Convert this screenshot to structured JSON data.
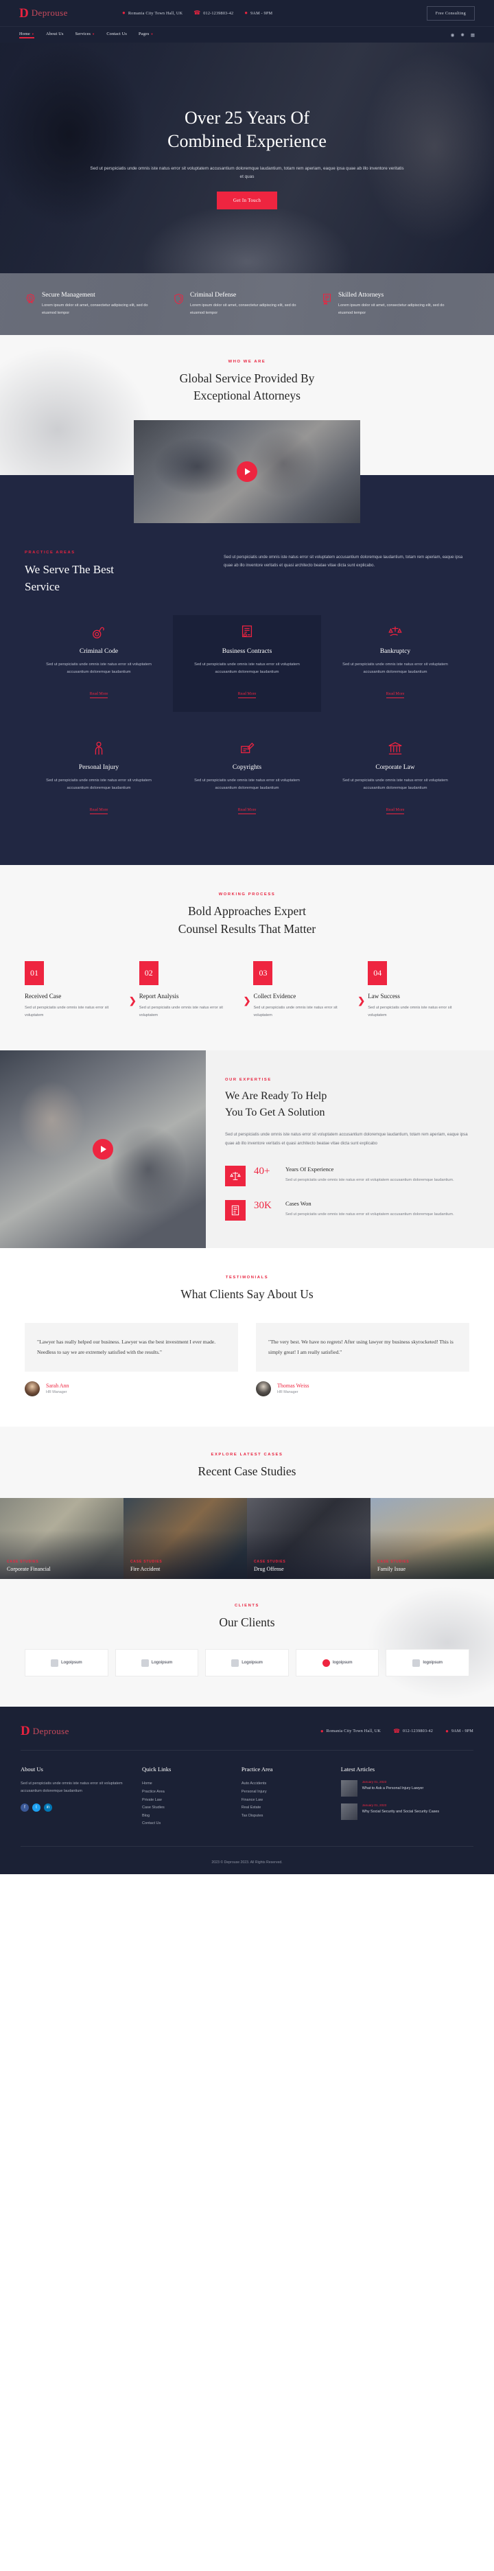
{
  "brand": {
    "mark": "D",
    "name": "Deprouse"
  },
  "topbar": {
    "info": [
      {
        "icon": "location-pin-icon",
        "text": "Romania City Town Hall, UK"
      },
      {
        "icon": "phone-icon",
        "text": "012-1239803-42"
      },
      {
        "icon": "clock-icon",
        "text": "9AM - 9PM"
      }
    ],
    "cta": "Free Consulting"
  },
  "nav": {
    "items": [
      {
        "label": "Home",
        "caret": true,
        "active": true
      },
      {
        "label": "About Us",
        "caret": false,
        "active": false
      },
      {
        "label": "Services",
        "caret": true,
        "active": false
      },
      {
        "label": "Contact Us",
        "caret": false,
        "active": false
      },
      {
        "label": "Pages",
        "caret": true,
        "active": false
      }
    ],
    "social": [
      {
        "icon": "facebook-icon",
        "glyph": "f"
      },
      {
        "icon": "twitter-icon",
        "glyph": "t"
      },
      {
        "icon": "linkedin-icon",
        "glyph": "in"
      }
    ]
  },
  "hero": {
    "title_line1": "Over 25 Years Of",
    "title_line2": "Combined Experience",
    "description": "Sed ut perspiciatis unde omnis iste natus error sit voluptatem accusantium doloremque laudantium, totam rem aperiam, eaque ipsa quae ab illo inventore veritatis et quas",
    "button": "Get In Touch"
  },
  "features": [
    {
      "icon": "badge-star-icon",
      "title": "Secure Management",
      "text": "Lorem ipsum dolor sit amet, consectetur adipiscing elit, sed do eiusmod tempor"
    },
    {
      "icon": "shield-icon",
      "title": "Criminal Defense",
      "text": "Lorem ipsum dolor sit amet, consectetur adipiscing elit, sed do eiusmod tempor"
    },
    {
      "icon": "certificate-icon",
      "title": "Skilled Attorneys",
      "text": "Lorem ipsum dolor sit amet, consectetur adipiscing elit, sed do eiusmod tempor"
    }
  ],
  "whoweare": {
    "eyebrow": "WHO WE ARE",
    "title_line1": "Global Service Provided By",
    "title_line2": "Exceptional Attorneys",
    "play": "play-button-icon"
  },
  "practice": {
    "eyebrow": "PRACTICE AREAS",
    "title_line1": "We Serve The Best",
    "title_line2": "Service",
    "description": "Sed ut perspiciatis unde omnis iste natus error sit voluptatem accusantium doloremque laudantium, totam rem aperiam, eaque ipsa quae ab illo inventore veritatis et quasi architecto beatae vitae dicta sunt explicabo.",
    "cards": [
      {
        "icon": "handcuffs-icon",
        "title": "Criminal Code",
        "text": "Sed ut perspiciatis unde omnis iste natus error sit voluptatem accusantium doloremque laudantium",
        "link": "Read More",
        "highlight": false
      },
      {
        "icon": "contract-document-icon",
        "title": "Business Contracts",
        "text": "Sed ut perspiciatis unde omnis iste natus error sit voluptatem accusantium doloremque laudantium",
        "link": "Read More",
        "highlight": true
      },
      {
        "icon": "scales-hand-icon",
        "title": "Bankruptcy",
        "text": "Sed ut perspiciatis unde omnis iste natus error sit voluptatem accusantium doloremque laudantium",
        "link": "Read More",
        "highlight": false
      },
      {
        "icon": "injured-person-icon",
        "title": "Personal Injury",
        "text": "Sed ut perspiciatis unde omnis iste natus error sit voluptatem accusantium doloremque laudantium",
        "link": "Read More",
        "highlight": false
      },
      {
        "icon": "signature-pen-icon",
        "title": "Copyrights",
        "text": "Sed ut perspiciatis unde omnis iste natus error sit voluptatem accusantium doloremque laudantium",
        "link": "Read More",
        "highlight": false
      },
      {
        "icon": "bank-building-icon",
        "title": "Corporate Law",
        "text": "Sed ut perspiciatis unde omnis iste natus error sit voluptatem accusantium doloremque laudantium",
        "link": "Read More",
        "highlight": false
      }
    ]
  },
  "process": {
    "eyebrow": "WORKING PROCESS",
    "title_line1": "Bold Approaches Expert",
    "title_line2": "Counsel Results That Matter",
    "arrow": "chevron-right-icon",
    "steps": [
      {
        "num": "01",
        "title": "Received Case",
        "text": "Sed ut perspiciatis unde omnis iste natus error sit voluptatem"
      },
      {
        "num": "02",
        "title": "Report Analysis",
        "text": "Sed ut perspiciatis unde omnis iste natus error sit voluptatem"
      },
      {
        "num": "03",
        "title": "Collect Evidence",
        "text": "Sed ut perspiciatis unde omnis iste natus error sit voluptatem"
      },
      {
        "num": "04",
        "title": "Law Success",
        "text": "Sed ut perspiciatis unde omnis iste natus error sit voluptatem"
      }
    ]
  },
  "expertise": {
    "eyebrow": "OUR EXPERTISE",
    "title_line1": "We Are Ready To Help",
    "title_line2": "You To Get A Solution",
    "description": "Sed ut perspiciatis unde omnis iste natus error sit voluptatem accusantium doloremque laudantium, totam rem aperiam, eaque ipsa quae ab illo inventore veritatis et quasi architecto beatae vitae dicta sunt explicabo",
    "play": "play-button-icon",
    "counters": [
      {
        "icon": "scales-icon",
        "number": "40+",
        "title": "Years Of Experience",
        "text": "Sed ut perspiciatis unde omnis iste natus error sit voluptatem accusantium doloremque laudantium."
      },
      {
        "icon": "case-file-icon",
        "number": "30K",
        "title": "Cases Won",
        "text": "Sed ut perspiciatis unde omnis iste natus error sit voluptatem accusantium doloremque laudantium."
      }
    ]
  },
  "testimonials": {
    "eyebrow": "TESTIMONIALS",
    "title": "What Clients Say About Us",
    "items": [
      {
        "quote": "\"Lawyer has really helped our business. Lawyer was the best investment I ever made. Needless to say we are extremely satisfied with the results.\"",
        "name": "Sarah Ann",
        "role": "HR Manager"
      },
      {
        "quote": "\"The very best. We have no regrets! After using lawyer my business skyrocketed! This is simply great! I am really satisfied.\"",
        "name": "Thomas Weiss",
        "role": "HR Manager"
      }
    ]
  },
  "cases": {
    "eyebrow": "EXPLORE LATEST CASES",
    "title": "Recent Case Studies",
    "items": [
      {
        "tag": "CASE STUDIES",
        "name": "Corporate Financial"
      },
      {
        "tag": "CASE STUDIES",
        "name": "Fire Accident"
      },
      {
        "tag": "CASE STUDIES",
        "name": "Drug Offense"
      },
      {
        "tag": "CASE STUDIES",
        "name": "Family Issue"
      }
    ]
  },
  "clients": {
    "eyebrow": "CLIENTS",
    "title": "Our Clients",
    "logos": [
      {
        "text": "Logoipsum",
        "mark": "square"
      },
      {
        "text": "Logoipsum",
        "mark": "square"
      },
      {
        "text": "Logoipsum",
        "mark": "square"
      },
      {
        "text": "logoipsum",
        "mark": "circle"
      },
      {
        "text": "logoipsum",
        "mark": "square"
      }
    ]
  },
  "footer": {
    "info": [
      {
        "icon": "location-pin-icon",
        "text": "Romania City Town Hall, UK"
      },
      {
        "icon": "phone-icon",
        "text": "012-1239803-42"
      },
      {
        "icon": "clock-icon",
        "text": "9AM - 9PM"
      }
    ],
    "about": {
      "heading": "About Us",
      "text": "Sed ut perspiciatis unde omnis iste natus error sit voluptatem accusantium doloremque laudantium",
      "social": [
        {
          "icon": "facebook-icon",
          "glyph": "f"
        },
        {
          "icon": "twitter-icon",
          "glyph": "t"
        },
        {
          "icon": "linkedin-icon",
          "glyph": "in"
        }
      ]
    },
    "quick": {
      "heading": "Quick Links",
      "links": [
        "Home",
        "Practice Area",
        "Private Law",
        "Case Studies",
        "Blog",
        "Contact Us"
      ]
    },
    "practice": {
      "heading": "Practice Area",
      "links": [
        "Auto Accidents",
        "Personal Injury",
        "Finance Law",
        "Real Estate",
        "Tax Disputes"
      ]
    },
    "articles": {
      "heading": "Latest Articles",
      "items": [
        {
          "date": "January 01, 2023",
          "title": "What to Ask a Personal Injury Lawyer"
        },
        {
          "date": "January 01, 2023",
          "title": "Why Social Security and Social Security Cases"
        }
      ]
    },
    "copyright": "2023 © Deprouse 2023. All Rights Reserved."
  },
  "colors": {
    "accent": "#ee2540",
    "dark": "#1b2135",
    "dark_alt": "#212742",
    "light": "#f7f7f7"
  }
}
